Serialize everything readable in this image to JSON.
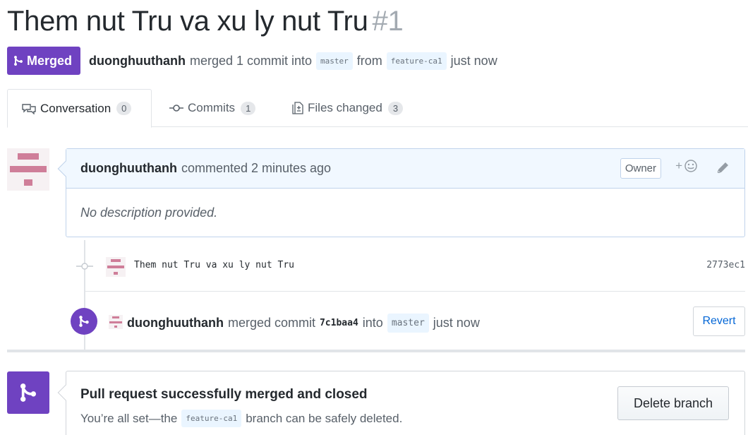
{
  "pr": {
    "title": "Them nut Tru va xu ly nut Tru",
    "number": "#1",
    "state_label": "Merged",
    "author": "duonghuuthanh",
    "merge_summary": "merged 1 commit into",
    "base_branch": "master",
    "from_text": "from",
    "head_branch": "feature-ca1",
    "time": "just now"
  },
  "tabs": [
    {
      "label": "Conversation",
      "count": "0",
      "icon": "comment-discussion-icon"
    },
    {
      "label": "Commits",
      "count": "1",
      "icon": "git-commit-icon"
    },
    {
      "label": "Files changed",
      "count": "3",
      "icon": "file-diff-icon"
    }
  ],
  "comment": {
    "author": "duonghuuthanh",
    "action": "commented 2 minutes ago",
    "role_badge": "Owner",
    "reaction_label": "+",
    "body": "No description provided."
  },
  "commit": {
    "message": "Them nut Tru va xu ly nut Tru",
    "sha": "2773ec1"
  },
  "merge_event": {
    "author": "duonghuuthanh",
    "text": "merged commit",
    "sha": "7c1baa4",
    "into": "into",
    "branch": "master",
    "time": "just now",
    "revert_label": "Revert"
  },
  "merged_box": {
    "heading": "Pull request successfully merged and closed",
    "sub_prefix": "You’re all set—the",
    "branch": "feature-ca1",
    "sub_suffix": "branch can be safely deleted.",
    "delete_label": "Delete branch"
  },
  "colors": {
    "merged_purple": "#6f42c1",
    "link_blue": "#0366d6",
    "avatar_pink": "#cf7e99"
  }
}
